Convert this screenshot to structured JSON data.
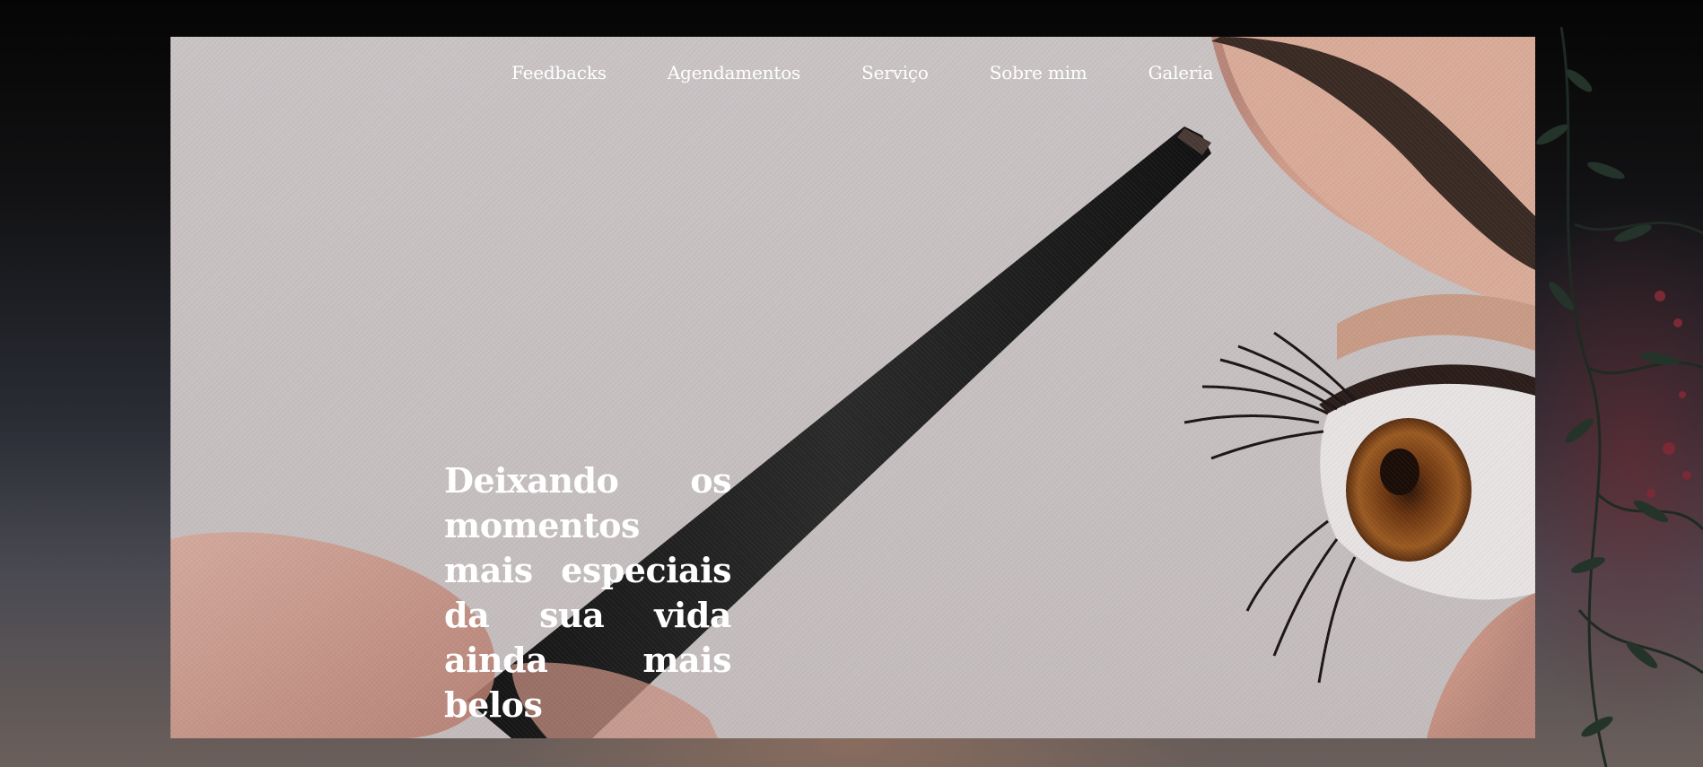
{
  "nav": {
    "items": [
      {
        "label": "Feedbacks"
      },
      {
        "label": "Agendamentos"
      },
      {
        "label": "Serviço"
      },
      {
        "label": "Sobre mim"
      },
      {
        "label": "Galeria"
      }
    ]
  },
  "hero": {
    "headline": "Deixando os momentos mais especiais da sua vida ainda mais belos"
  },
  "colors": {
    "page_background": "#000000",
    "hero_background": "#c9c3c4",
    "text": "#ffffff"
  }
}
